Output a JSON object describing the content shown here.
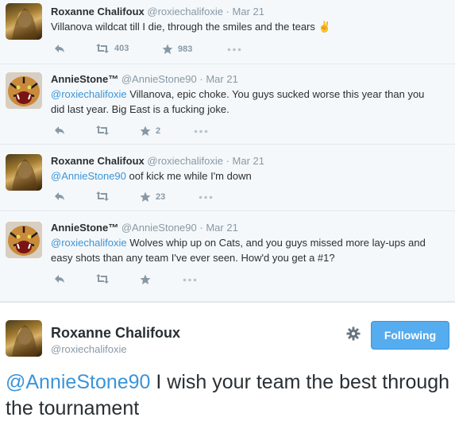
{
  "tweets": [
    {
      "name": "Roxanne Chalifoux",
      "handle": "@roxiechalifoxie",
      "sep": "·",
      "date": "Mar 21",
      "mention": "",
      "text": "Villanova wildcat till I die, through the smiles and the tears",
      "emoji": "✌️",
      "retweets": "403",
      "favorites": "983"
    },
    {
      "name": "AnnieStone™",
      "handle": "@AnnieStone90",
      "sep": "·",
      "date": "Mar 21",
      "mention": "@roxiechalifoxie",
      "text": " Villanova, epic choke.  You guys sucked worse this year than you did last year.  Big East is a fucking joke.",
      "retweets": "",
      "favorites": "2"
    },
    {
      "name": "Roxanne Chalifoux",
      "handle": "@roxiechalifoxie",
      "sep": "·",
      "date": "Mar 21",
      "mention": "@AnnieStone90",
      "text": " oof kick me while I'm down",
      "retweets": "",
      "favorites": "23"
    },
    {
      "name": "AnnieStone™",
      "handle": "@AnnieStone90",
      "sep": "·",
      "date": "Mar 21",
      "mention": "@roxiechalifoxie",
      "text": " Wolves whip up on Cats, and you guys missed more lay-ups and easy shots than any team I've ever seen. How'd you get a #1?",
      "retweets": "",
      "favorites": ""
    }
  ],
  "main_tweet": {
    "name": "Roxanne Chalifoux",
    "handle": "@roxiechalifoxie",
    "follow_label": "Following",
    "mention": "@AnnieStone90",
    "text": " I wish your team the best through the tournament"
  },
  "colors": {
    "link": "#3b94d9",
    "follow_button": "#55acee",
    "meta": "#8899a6",
    "timeline_bg": "#f5f8fa"
  },
  "icons": [
    "reply-icon",
    "retweet-icon",
    "favorite-icon",
    "more-icon",
    "gear-icon",
    "victory-hand-icon"
  ]
}
